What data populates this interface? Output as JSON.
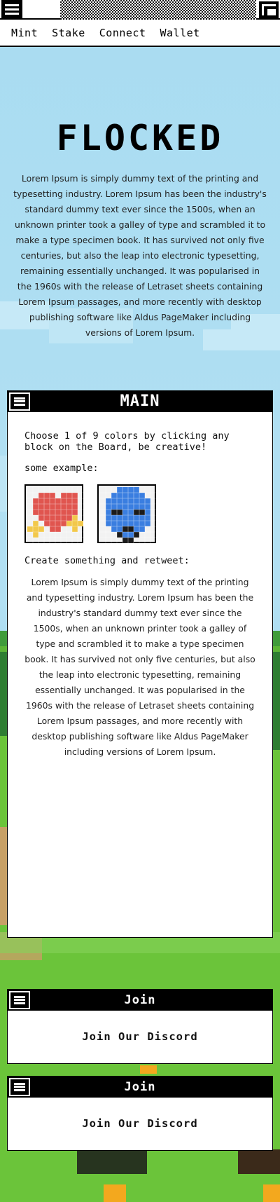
{
  "topbar": {
    "nav": [
      "Mint",
      "Stake",
      "Connect",
      "Wallet"
    ]
  },
  "hero": {
    "title": "FLOCKED",
    "text": "Lorem Ipsum is simply dummy text of the printing and typesetting industry. Lorem Ipsum has been the industry's standard dummy text ever since the 1500s, when an unknown printer took a galley of type and scrambled it to make a type specimen book. It has survived not only five centuries, but also the leap into electronic typesetting, remaining essentially unchanged. It was popularised in the 1960s with the release of Letraset sheets containing Lorem Ipsum passages, and more recently with desktop publishing software like Aldus PageMaker including versions of Lorem Ipsum."
  },
  "main_window": {
    "title": "MAIN",
    "instruction": "Choose 1 of 9 colors by clicking any block on the Board, be creative!",
    "example_label": "some example:",
    "tweet_label": "Create something and retweet:",
    "text": "Lorem Ipsum is simply dummy text of the printing and typesetting industry. Lorem Ipsum has been the industry's standard dummy text ever since the 1500s, when an unknown printer took a galley of type and scrambled it to make a type specimen book. It has survived not only five centuries, but also the leap into electronic typesetting, remaining essentially unchanged. It was popularised in the 1960s with the release of Letraset sheets containing Lorem Ipsum passages, and more recently with desktop publishing software like Aldus PageMaker including versions of Lorem Ipsum."
  },
  "join_windows": [
    {
      "title": "Join",
      "link": "Join Our Discord"
    },
    {
      "title": "Join",
      "link": "Join Our Discord"
    }
  ],
  "colors": {
    "sky": "#a9dcf1",
    "grass": "#6bc43a",
    "heart_red": "#e0554f",
    "star_yellow": "#f2c84b",
    "blob_blue": "#3a7ee0"
  },
  "icons": {
    "menu": "hamburger-icon",
    "corner": "window-resize-icon"
  }
}
